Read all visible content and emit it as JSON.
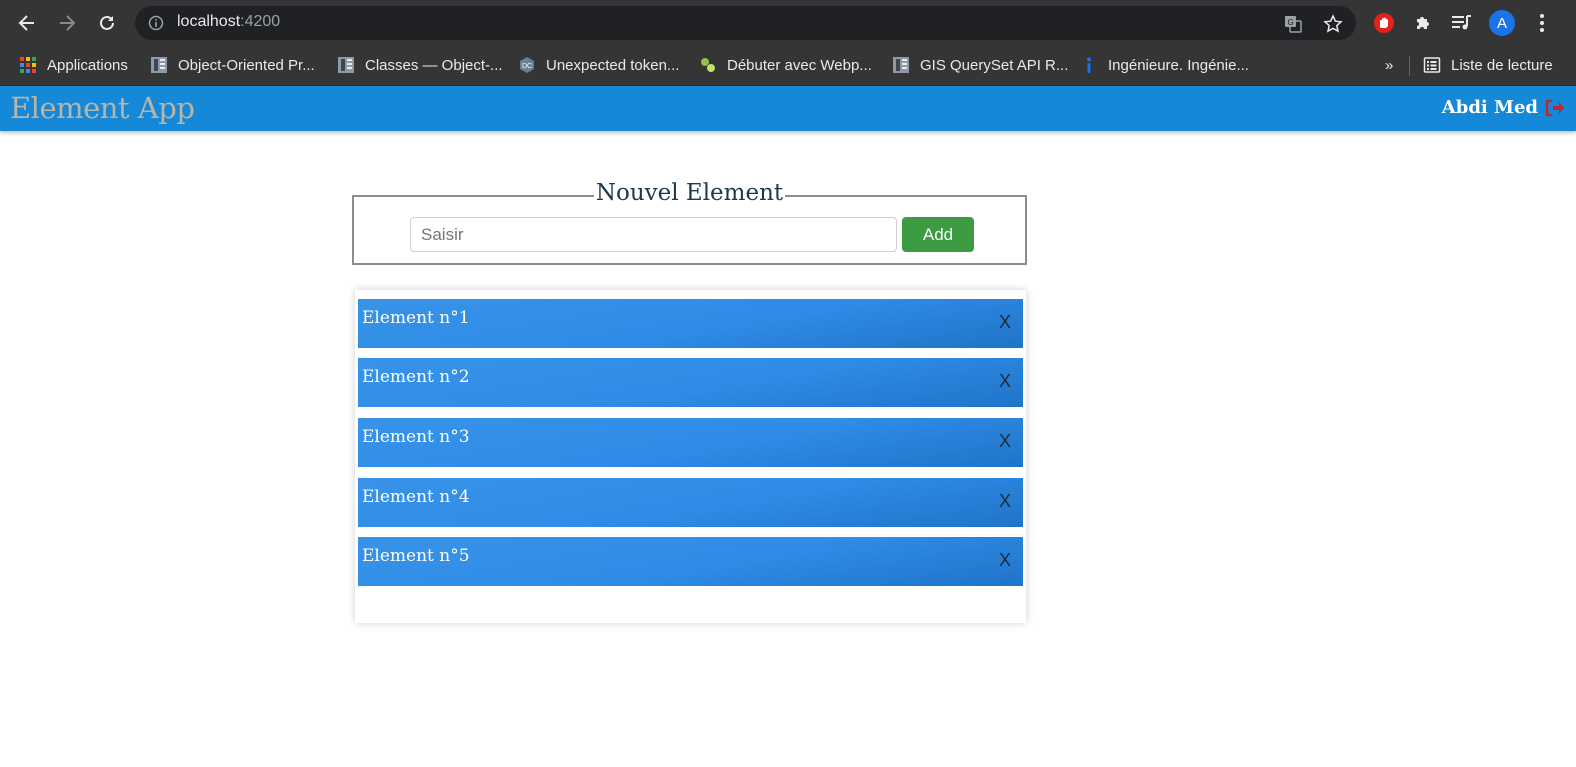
{
  "browser": {
    "url_host": "localhost",
    "url_port": ":4200",
    "profile_initial": "A",
    "bookmarks": [
      {
        "label": "Applications",
        "icon": "apps-grid-icon"
      },
      {
        "label": "Object-Oriented Pr...",
        "icon": "doc-icon"
      },
      {
        "label": "Classes — Object-...",
        "icon": "doc-icon"
      },
      {
        "label": "Unexpected token...",
        "icon": "dc-icon"
      },
      {
        "label": "Débuter avec Webp...",
        "icon": "webpack-icon"
      },
      {
        "label": "GIS QuerySet API R...",
        "icon": "doc-icon"
      },
      {
        "label": "Ingénieure. Ingénie...",
        "icon": "info-icon"
      }
    ],
    "more_bookmarks": "»",
    "reading_list": "Liste de lecture"
  },
  "app": {
    "title": "Element App",
    "user_name": "Abdi Med"
  },
  "form": {
    "legend": "Nouvel Element",
    "input_placeholder": "Saisir",
    "input_value": "",
    "add_label": "Add"
  },
  "list": {
    "items": [
      {
        "label": "Element n°1",
        "close": "X"
      },
      {
        "label": "Element n°2",
        "close": "X"
      },
      {
        "label": "Element n°3",
        "close": "X"
      },
      {
        "label": "Element n°4",
        "close": "X"
      },
      {
        "label": "Element n°5",
        "close": "X"
      }
    ]
  },
  "colors": {
    "header": "#1588d8",
    "item": "#2f8be6",
    "add_button": "#3d9b41",
    "title_text": "#b5b5a8"
  }
}
